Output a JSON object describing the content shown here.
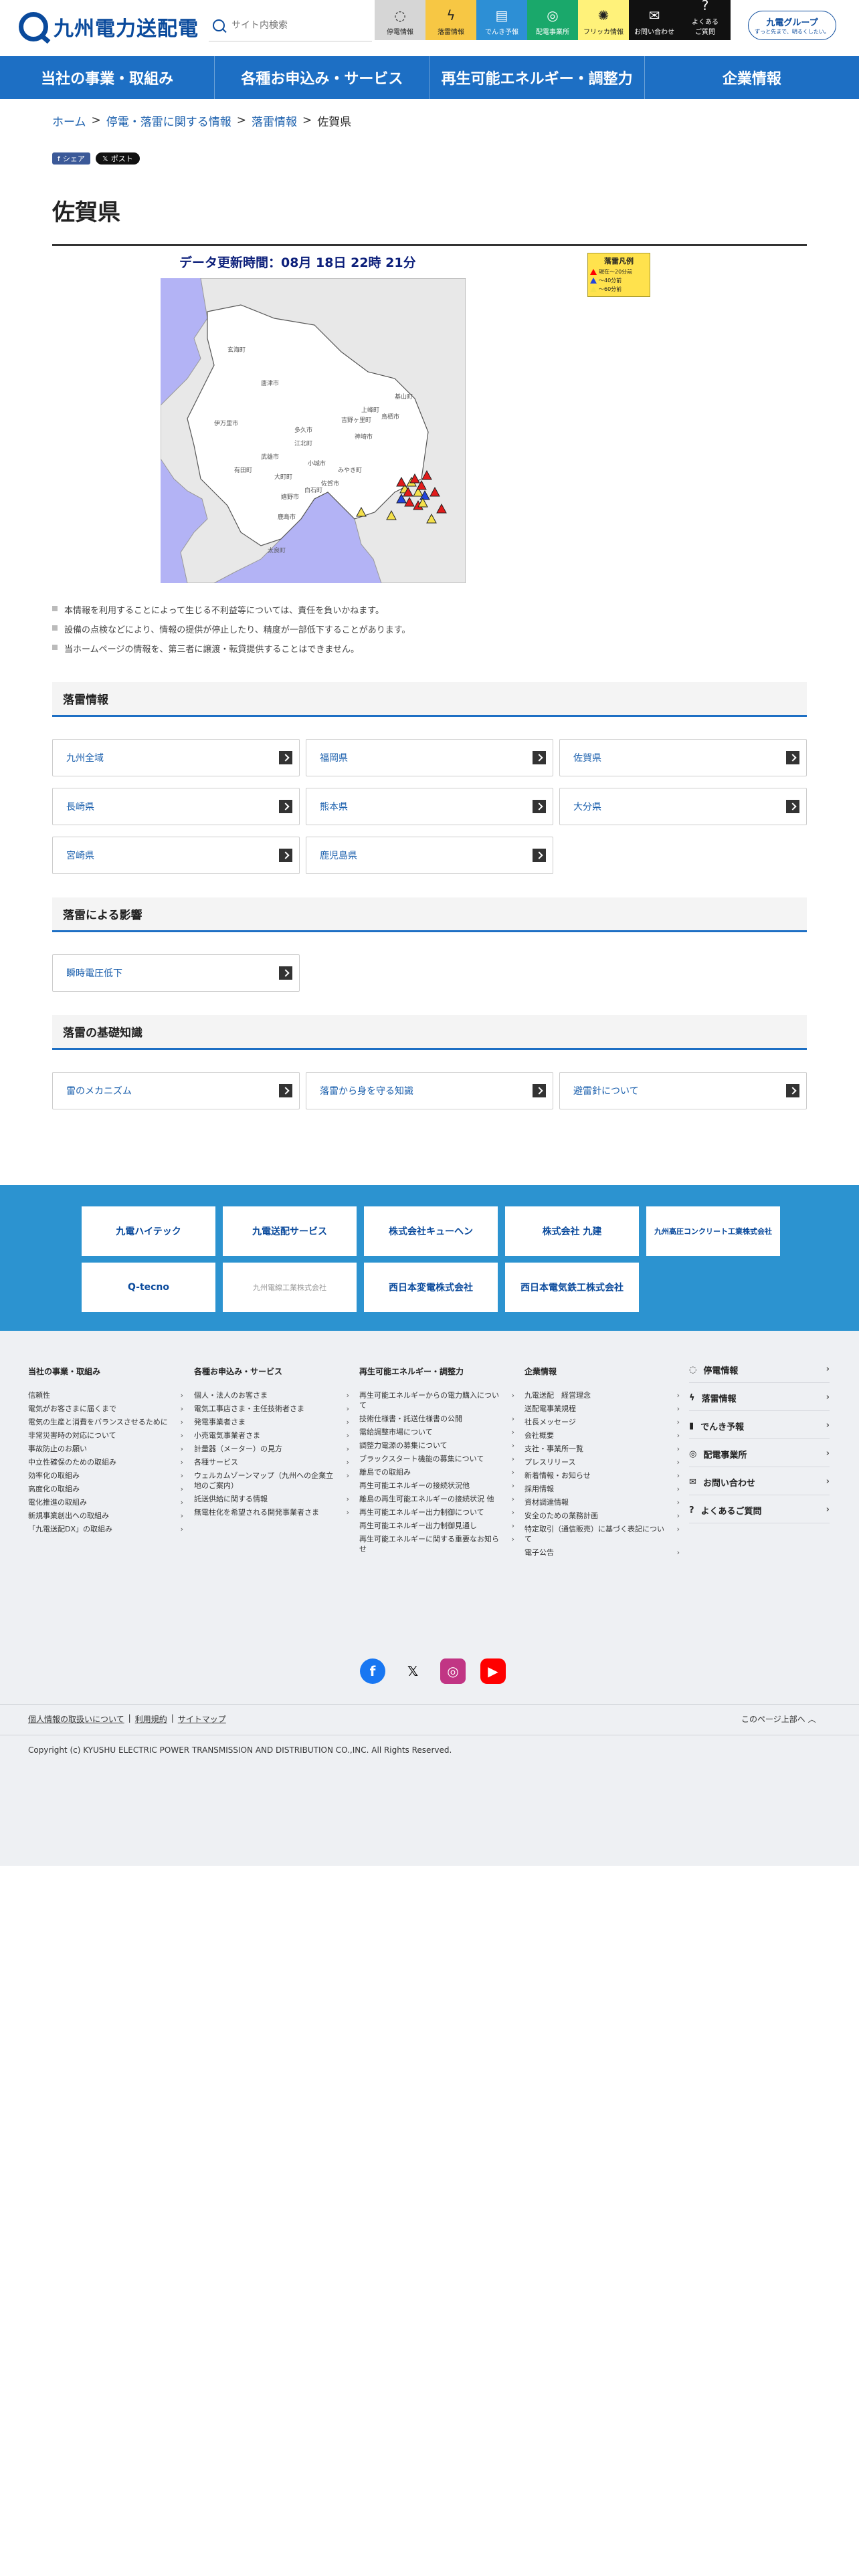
{
  "header": {
    "logo_text": "九州電力送配電",
    "search_placeholder": "サイト内検索",
    "quick_nav": [
      {
        "label": "停電情報",
        "icon": "bulb-icon",
        "bg": "#d6d6d6",
        "glyph": "◌"
      },
      {
        "label": "落雷情報",
        "icon": "lightning-icon",
        "bg": "#f7c744",
        "glyph": "ϟ"
      },
      {
        "label": "でんき予報",
        "icon": "meter-icon",
        "bg": "#2d8fd5",
        "glyph": "▤"
      },
      {
        "label": "配電事業所",
        "icon": "pin-icon",
        "bg": "#1aa86b",
        "glyph": "◎"
      },
      {
        "label": "フリッカ情報",
        "icon": "flicker-icon",
        "bg": "#fff27a",
        "glyph": "✺"
      },
      {
        "label": "お問い合わせ",
        "icon": "mail-icon",
        "bg": "#111111",
        "glyph": "✉"
      },
      {
        "label": "よくある\nご質問",
        "icon": "question-icon",
        "bg": "#111111",
        "glyph": "?"
      }
    ],
    "group_logo": "九電グループ",
    "group_tagline": "ずっと先まで、明るくしたい。"
  },
  "gnav": [
    "当社の事業・取組み",
    "各種お申込み・サービス",
    "再生可能エネルギー・調整力",
    "企業情報"
  ],
  "breadcrumb": {
    "home": "ホーム",
    "l1": "停電・落雷に関する情報",
    "l2": "落雷情報",
    "current": "佐賀県"
  },
  "share": {
    "fb": "シェア",
    "x": "ポスト"
  },
  "page_title": "佐賀県",
  "map": {
    "timestamp": "データ更新時間：08月 18日 22時 21分",
    "legend_title": "落雷凡例",
    "legend": [
      {
        "color": "#e11b1b",
        "label": "現在〜20分前"
      },
      {
        "color": "#2244dd",
        "label": "〜40分前"
      },
      {
        "color": "#f4e04a",
        "label": "〜60分前"
      }
    ],
    "cities": [
      "唐津市",
      "玄海町",
      "伊万里市",
      "有田町",
      "武雄市",
      "多久市",
      "小城市",
      "佐賀市",
      "神埼市",
      "吉野ヶ里町",
      "鳥栖市",
      "嬉野市",
      "鹿島市",
      "太良町",
      "白石町",
      "大町町",
      "江北町",
      "上峰町",
      "みやき町",
      "基山町"
    ]
  },
  "notes": [
    "本情報を利用することによって生じる不利益等については、責任を負いかねます。",
    "設備の点検などにより、情報の提供が停止したり、精度が一部低下することがあります。",
    "当ホームページの情報を、第三者に譲渡・転貸提供することはできません。"
  ],
  "lightning_info": {
    "heading": "落雷情報",
    "links": [
      "九州全域",
      "福岡県",
      "佐賀県",
      "長崎県",
      "熊本県",
      "大分県",
      "宮崎県",
      "鹿児島県"
    ]
  },
  "impact": {
    "heading": "落雷による影響",
    "links": [
      "瞬時電圧低下"
    ]
  },
  "basics": {
    "heading": "落雷の基礎知識",
    "links": [
      "雷のメカニズム",
      "落雷から身を守る知識",
      "避雷針について"
    ]
  },
  "group": [
    "九電ハイテック",
    "九電送配サービス",
    "株式会社キューヘン",
    "株式会社 九建",
    "九州高圧コンクリート工業株式会社",
    "Q-tecno",
    "九州電線工業株式会社",
    "西日本変電株式会社",
    "西日本電気鉄工株式会社"
  ],
  "footer": {
    "cols": [
      {
        "title": "当社の事業・取組み",
        "items": [
          "信頼性",
          "電気がお客さまに届くまで",
          "電気の生産と消費をバランスさせるために",
          "非常災害時の対応について",
          "事故防止のお願い",
          "中立性確保のための取組み",
          "効率化の取組み",
          "高度化の取組み",
          "電化推進の取組み",
          "新規事業創出への取組み",
          "「九電送配DX」の取組み"
        ]
      },
      {
        "title": "各種お申込み・サービス",
        "items": [
          "個人・法人のお客さま",
          "電気工事店さま・主任技術者さま",
          "発電事業者さま",
          "小売電気事業者さま",
          "計量器（メーター）の見方",
          "各種サービス",
          "ウェルカムゾーンマップ（九州への企業立地のご案内）",
          "託送供給に関する情報",
          "無電柱化を希望される開発事業者さま"
        ]
      },
      {
        "title": "再生可能エネルギー・調整力",
        "items": [
          "再生可能エネルギーからの電力購入について",
          "技術仕様書・託送仕様書の公開",
          "需給調整市場について",
          "調整力電源の募集について",
          "ブラックスタート機能の募集について",
          "離島での取組み",
          "再生可能エネルギーの接続状況他",
          "離島の再生可能エネルギーの接続状況 他",
          "再生可能エネルギー出力制御について",
          "再生可能エネルギー出力制御見通し",
          "再生可能エネルギーに関する重要なお知らせ"
        ]
      },
      {
        "title": "企業情報",
        "items": [
          "九電送配　経営理念",
          "送配電事業規程",
          "社長メッセージ",
          "会社概要",
          "支社・事業所一覧",
          "プレスリリース",
          "新着情報・お知らせ",
          "採用情報",
          "資材調達情報",
          "安全のための業務計画",
          "特定取引（通信販売）に基づく表記について",
          "電子公告"
        ]
      }
    ],
    "side": [
      {
        "label": "停電情報",
        "icon": "bulb-icon",
        "glyph": "◌"
      },
      {
        "label": "落雷情報",
        "icon": "lightning-icon",
        "glyph": "ϟ"
      },
      {
        "label": "でんき予報",
        "icon": "meter-icon",
        "glyph": "▮"
      },
      {
        "label": "配電事業所",
        "icon": "pin-icon",
        "glyph": "◎"
      },
      {
        "label": "お問い合わせ",
        "icon": "mail-icon",
        "glyph": "✉"
      },
      {
        "label": "よくあるご質問",
        "icon": "question-icon",
        "glyph": "?"
      }
    ],
    "bottom_links": [
      "個人情報の取扱いについて",
      "利用規約",
      "サイトマップ"
    ],
    "to_top": "このページ上部へ",
    "copyright": "Copyright (c) KYUSHU ELECTRIC POWER TRANSMISSION AND DISTRIBUTION CO.,INC. All Rights Reserved."
  }
}
